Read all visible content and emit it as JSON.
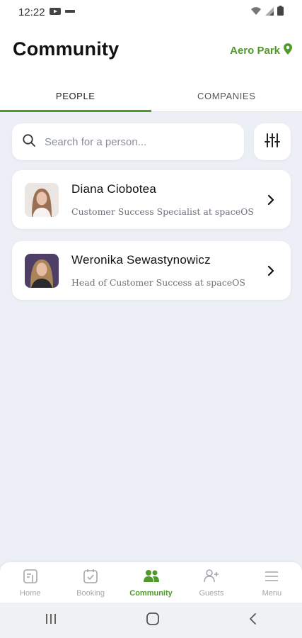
{
  "status_bar": {
    "time": "12:22"
  },
  "header": {
    "title": "Community",
    "location": "Aero Park"
  },
  "tabs": [
    {
      "label": "PEOPLE",
      "active": true
    },
    {
      "label": "COMPANIES",
      "active": false
    }
  ],
  "search": {
    "placeholder": "Search for a person..."
  },
  "people": [
    {
      "name": "Diana Ciobotea",
      "role": "Customer Success Specialist at spaceOS"
    },
    {
      "name": "Weronika Sewastynowicz",
      "role": "Head of Customer Success at spaceOS"
    }
  ],
  "bottom_nav": [
    {
      "label": "Home",
      "icon": "home-icon",
      "active": false
    },
    {
      "label": "Booking",
      "icon": "booking-icon",
      "active": false
    },
    {
      "label": "Community",
      "icon": "community-icon",
      "active": true
    },
    {
      "label": "Guests",
      "icon": "add-guest-icon",
      "active": false
    },
    {
      "label": "Menu",
      "icon": "menu-icon",
      "active": false
    }
  ],
  "colors": {
    "accent": "#4f9a2a",
    "background": "#eceff5"
  }
}
